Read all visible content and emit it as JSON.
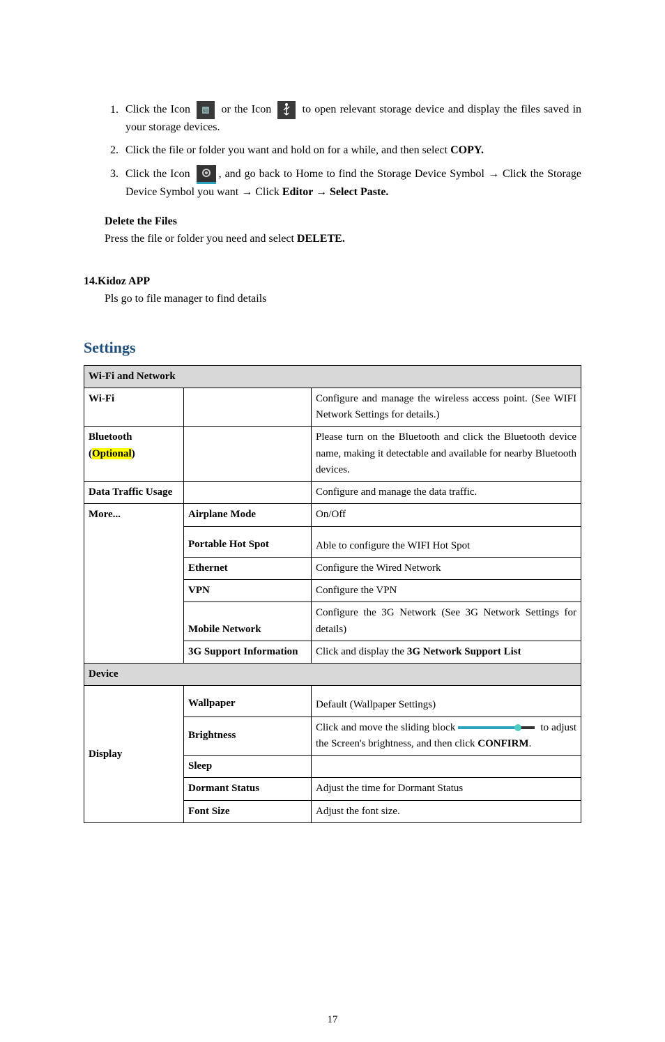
{
  "instructions": {
    "item1_part1": "Click the Icon ",
    "item1_part2": " or the Icon ",
    "item1_part3": " to open relevant storage device and display the files saved in your storage devices.",
    "item2_part1": "Click the file or folder you want and hold on for a while, and then select ",
    "item2_copy": "COPY.",
    "item3_part1": "Click the Icon ",
    "item3_part2": ", and go back to Home to find the Storage Device Symbol → Click the Storage Device Symbol you want → Click ",
    "item3_editor": "Editor",
    "item3_arrow": " → ",
    "item3_paste": "Select Paste."
  },
  "delete": {
    "heading": "Delete the Files",
    "body_part1": "Press the file or folder you need and select ",
    "body_bold": "DELETE."
  },
  "kidoz": {
    "heading": "14.Kidoz APP",
    "body": "Pls go to file manager to find details"
  },
  "settings_title": "Settings",
  "sections": {
    "wifi_network": "Wi-Fi and Network",
    "device": "Device"
  },
  "rows": {
    "wifi": {
      "label": "Wi-Fi",
      "desc": "Configure and manage the wireless access point. (See WIFI Network Settings for details.)"
    },
    "bluetooth": {
      "label": "Bluetooth",
      "optional_open": "(",
      "optional_word": "Optional",
      "optional_close": ")",
      "desc": "Please turn on the Bluetooth and click the Bluetooth device name, making it detectable and available for nearby Bluetooth devices."
    },
    "data_traffic": {
      "label": "Data Traffic Usage",
      "desc": "Configure and manage the data traffic."
    },
    "more": {
      "label": "More...",
      "airplane_l": "Airplane Mode",
      "airplane_d": "On/Off",
      "hotspot_l": "Portable Hot Spot",
      "hotspot_d": "Able to configure the WIFI Hot Spot",
      "ethernet_l": "Ethernet",
      "ethernet_d": "Configure the Wired Network",
      "vpn_l": "VPN",
      "vpn_d": "Configure the VPN",
      "mobile_l": "Mobile Network",
      "mobile_d": "Configure the 3G Network (See 3G Network Settings for details)",
      "support_l": "3G Support Information",
      "support_d_pre": "Click and display the ",
      "support_d_bold": "3G Network Support List"
    },
    "display": {
      "label": "Display",
      "wallpaper_l": "Wallpaper",
      "wallpaper_d": "Default (Wallpaper Settings)",
      "brightness_l": "Brightness",
      "brightness_d_pre": "Click and move the sliding block",
      "brightness_d_post": " to adjust the Screen's brightness, and then click ",
      "brightness_d_bold": "CONFIRM",
      "brightness_d_dot": ".",
      "sleep_l": "Sleep",
      "sleep_d": "",
      "dormant_l": "Dormant Status",
      "dormant_d": "Adjust the time for Dormant Status",
      "fontsize_l": "Font Size",
      "fontsize_d": "Adjust the font size."
    }
  },
  "page_number": "17"
}
